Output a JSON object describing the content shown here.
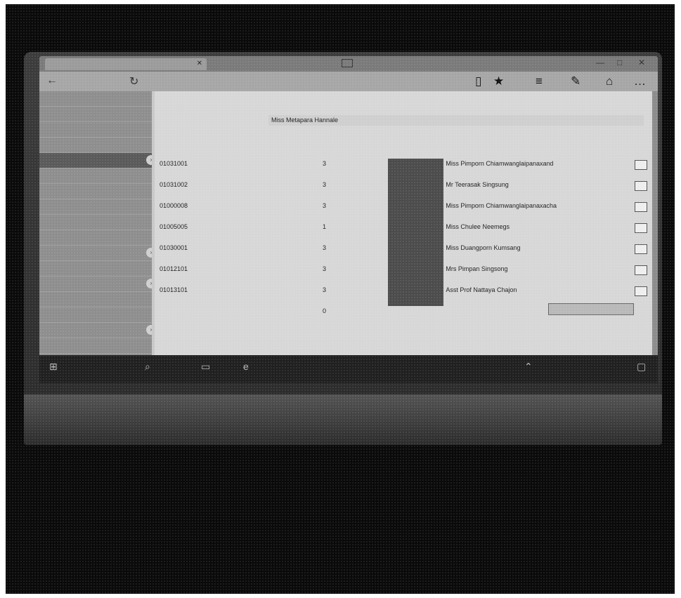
{
  "browser": {
    "tab_title": "",
    "address": "",
    "icons": [
      "back-icon",
      "refresh-icon",
      "reading-view-icon",
      "star-icon",
      "hub-icon",
      "note-icon",
      "share-icon",
      "more-icon"
    ]
  },
  "sidebar": {
    "items": [
      {
        "label": ""
      },
      {
        "label": ""
      },
      {
        "label": ""
      },
      {
        "label": ""
      },
      {
        "label": ""
      },
      {
        "label": ""
      },
      {
        "label": ""
      },
      {
        "label": ""
      },
      {
        "label": ""
      },
      {
        "label": ""
      },
      {
        "label": ""
      },
      {
        "label": ""
      },
      {
        "label": ""
      },
      {
        "label": ""
      },
      {
        "label": ""
      },
      {
        "label": ""
      },
      {
        "label": ""
      }
    ],
    "active_index": 4
  },
  "info": {
    "row1_label": "",
    "row1_value": "",
    "row2_label": "",
    "row2_value": "",
    "row3_label": "",
    "row3_value": "Miss Metapara Hannale",
    "section_title": ""
  },
  "table": {
    "headers": {
      "code": "",
      "credit": "",
      "type": "",
      "section": "",
      "instructor": "",
      "action": ""
    },
    "rows": [
      {
        "code": "01031001",
        "name": "",
        "credit": "3 ",
        "type": "",
        "section": "",
        "instructor": "Miss Pimporn Chiamwanglaipanaxand",
        "action": ""
      },
      {
        "code": "01031002",
        "name": "",
        "credit": "3 ",
        "type": "",
        "section": "",
        "instructor": "Mr Teerasak Singsung",
        "action": ""
      },
      {
        "code": "01000008",
        "name": "",
        "credit": "3 ",
        "type": "",
        "section": "",
        "instructor": "Miss Pimporn Chiamwanglaipanaxacha",
        "action": ""
      },
      {
        "code": "01005005",
        "name": "",
        "credit": "1 ",
        "type": "",
        "section": "",
        "instructor": "Miss Chulee Neemegs",
        "action": ""
      },
      {
        "code": "01030001",
        "name": "",
        "credit": "3 ",
        "type": "",
        "section": "",
        "instructor": "Miss Duangporn Kumsang",
        "action": ""
      },
      {
        "code": "01012101",
        "name": "",
        "credit": "3 ",
        "type": "",
        "section": "",
        "instructor": "Mrs Pimpan Singsong",
        "action": ""
      },
      {
        "code": "01013101",
        "name": "",
        "credit": "3 ",
        "type": "",
        "section": "",
        "instructor": "Asst Prof Nattaya Chajon",
        "action": ""
      }
    ],
    "total_label": "",
    "total_credit": "0"
  },
  "summary_text": "",
  "submit_label": "",
  "taskbar": {
    "icons": [
      "start-icon",
      "search-icon",
      "task-view-icon",
      "edge-icon",
      "explorer-icon",
      "tray-icon",
      "notification-icon"
    ]
  }
}
